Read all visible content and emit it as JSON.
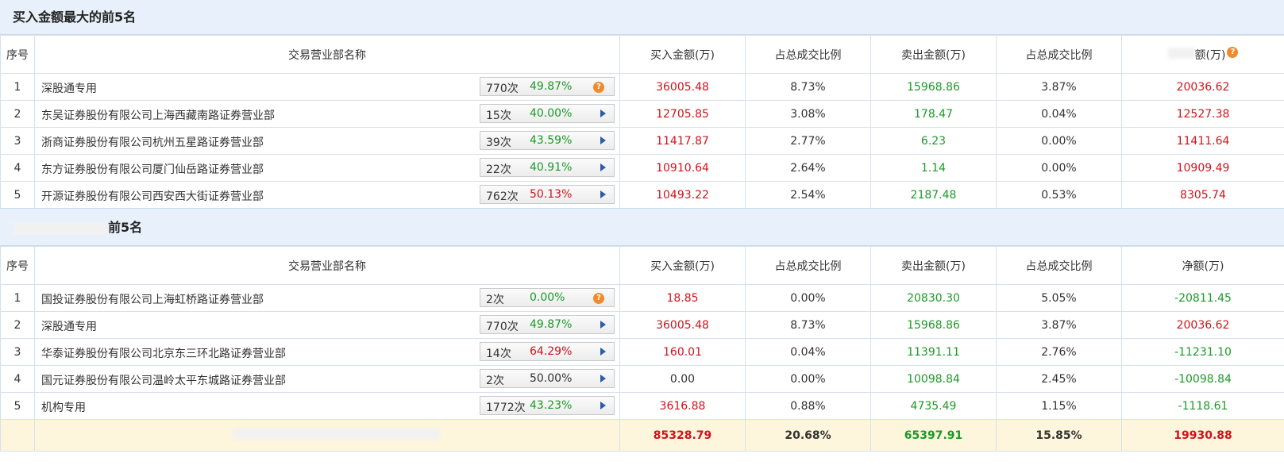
{
  "buy_section": {
    "title": "买入金额最大的前5名",
    "headers": [
      "序号",
      "交易营业部名称",
      "买入金额(万)",
      "占总成交比例",
      "卖出金额(万)",
      "占总成交比例",
      "额(万)"
    ],
    "rows": [
      {
        "idx": "1",
        "name": "深股通专用",
        "count": "770次",
        "rate": "49.87%",
        "rate_color": "green",
        "icon": "help-icon",
        "buy": "36005.48",
        "buy_pct": "8.73%",
        "sell": "15968.86",
        "sell_pct": "3.87%",
        "net": "20036.62",
        "net_color": "red"
      },
      {
        "idx": "2",
        "name": "东吴证券股份有限公司上海西藏南路证券营业部",
        "count": "15次",
        "rate": "40.00%",
        "rate_color": "green",
        "icon": "arrow-right-icon",
        "buy": "12705.85",
        "buy_pct": "3.08%",
        "sell": "178.47",
        "sell_pct": "0.04%",
        "net": "12527.38",
        "net_color": "red"
      },
      {
        "idx": "3",
        "name": "浙商证券股份有限公司杭州五星路证券营业部",
        "count": "39次",
        "rate": "43.59%",
        "rate_color": "green",
        "icon": "arrow-right-icon",
        "buy": "11417.87",
        "buy_pct": "2.77%",
        "sell": "6.23",
        "sell_pct": "0.00%",
        "net": "11411.64",
        "net_color": "red"
      },
      {
        "idx": "4",
        "name": "东方证券股份有限公司厦门仙岳路证券营业部",
        "count": "22次",
        "rate": "40.91%",
        "rate_color": "green",
        "icon": "arrow-right-icon",
        "buy": "10910.64",
        "buy_pct": "2.64%",
        "sell": "1.14",
        "sell_pct": "0.00%",
        "net": "10909.49",
        "net_color": "red"
      },
      {
        "idx": "5",
        "name": "开源证券股份有限公司西安西大街证券营业部",
        "count": "762次",
        "rate": "50.13%",
        "rate_color": "red",
        "icon": "arrow-right-icon",
        "buy": "10493.22",
        "buy_pct": "2.54%",
        "sell": "2187.48",
        "sell_pct": "0.53%",
        "net": "8305.74",
        "net_color": "red"
      }
    ]
  },
  "sell_section": {
    "title": "前5名",
    "headers": [
      "序号",
      "交易营业部名称",
      "买入金额(万)",
      "占总成交比例",
      "卖出金额(万)",
      "占总成交比例",
      "净额(万)"
    ],
    "rows": [
      {
        "idx": "1",
        "name": "国投证券股份有限公司上海虹桥路证券营业部",
        "count": "2次",
        "rate": "0.00%",
        "rate_color": "green",
        "icon": "help-icon",
        "buy": "18.85",
        "buy_color": "red",
        "buy_pct": "0.00%",
        "sell": "20830.30",
        "sell_pct": "5.05%",
        "net": "-20811.45",
        "net_color": "green"
      },
      {
        "idx": "2",
        "name": "深股通专用",
        "count": "770次",
        "rate": "49.87%",
        "rate_color": "green",
        "icon": "arrow-right-icon",
        "buy": "36005.48",
        "buy_color": "red",
        "buy_pct": "8.73%",
        "sell": "15968.86",
        "sell_pct": "3.87%",
        "net": "20036.62",
        "net_color": "red"
      },
      {
        "idx": "3",
        "name": "华泰证券股份有限公司北京东三环北路证券营业部",
        "count": "14次",
        "rate": "64.29%",
        "rate_color": "red",
        "icon": "arrow-right-icon",
        "buy": "160.01",
        "buy_color": "red",
        "buy_pct": "0.04%",
        "sell": "11391.11",
        "sell_pct": "2.76%",
        "net": "-11231.10",
        "net_color": "green"
      },
      {
        "idx": "4",
        "name": "国元证券股份有限公司温岭太平东城路证券营业部",
        "count": "2次",
        "rate": "50.00%",
        "rate_color": "black",
        "icon": "arrow-right-icon",
        "buy": "0.00",
        "buy_color": "black",
        "buy_pct": "0.00%",
        "sell": "10098.84",
        "sell_pct": "2.45%",
        "net": "-10098.84",
        "net_color": "green"
      },
      {
        "idx": "5",
        "name": "机构专用",
        "count": "1772次",
        "rate": "43.23%",
        "rate_color": "green",
        "icon": "arrow-right-icon",
        "buy": "3616.88",
        "buy_color": "red",
        "buy_pct": "0.88%",
        "sell": "4735.49",
        "sell_pct": "1.15%",
        "net": "-1118.61",
        "net_color": "green"
      }
    ],
    "total": {
      "buy": "85328.79",
      "buy_pct": "20.68%",
      "sell": "65397.91",
      "sell_pct": "15.85%",
      "net": "19930.88"
    }
  },
  "icons": {
    "help": "?",
    "arrow": "▶"
  },
  "colors": {
    "red": "#d0121b",
    "green": "#1b9a26",
    "header_bg": "#e8f1fb",
    "total_bg": "#fdf6dc"
  }
}
